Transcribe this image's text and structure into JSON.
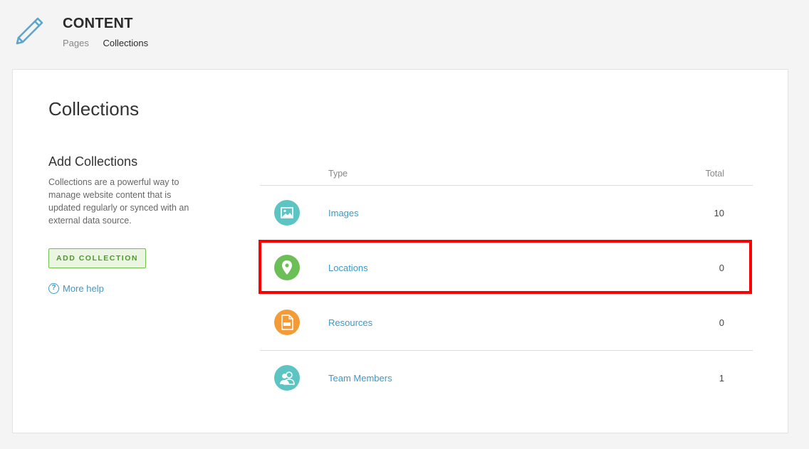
{
  "header": {
    "title": "CONTENT",
    "icon": "pencil-icon",
    "breadcrumbs": [
      {
        "label": "Pages",
        "active": false
      },
      {
        "label": "Collections",
        "active": true
      }
    ]
  },
  "main": {
    "title": "Collections",
    "sidebar": {
      "title": "Add Collections",
      "description": "Collections are a powerful way to manage website content that is updated regularly or synced with an external data source.",
      "add_button": "ADD COLLECTION",
      "help_link": "More help"
    },
    "table": {
      "headers": {
        "type": "Type",
        "total": "Total"
      },
      "rows": [
        {
          "name": "Images",
          "total": "10",
          "icon": "image-icon",
          "color": "#5cc4c2"
        },
        {
          "name": "Locations",
          "total": "0",
          "icon": "map-pin-icon",
          "color": "#6cbf56"
        },
        {
          "name": "Resources",
          "total": "0",
          "icon": "pdf-file-icon",
          "color": "#f29b37"
        },
        {
          "name": "Team Members",
          "total": "1",
          "icon": "people-icon",
          "color": "#5cc4c2"
        }
      ]
    }
  },
  "colors": {
    "link": "#3e98c4",
    "accent_green": "#72be4f",
    "highlight": "#ff0000"
  }
}
